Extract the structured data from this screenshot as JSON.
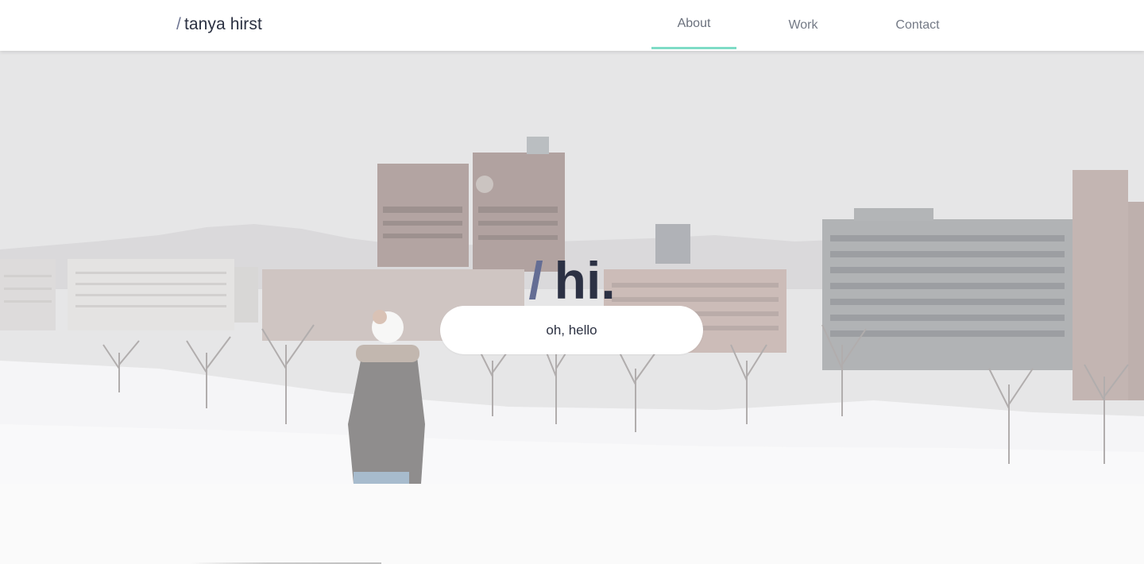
{
  "brand": {
    "slash": "/",
    "name": "tanya hirst"
  },
  "nav": {
    "items": [
      {
        "label": "About",
        "active": true
      },
      {
        "label": "Work",
        "active": false
      },
      {
        "label": "Contact",
        "active": false
      }
    ],
    "active_indicator_color": "#7fdcc6"
  },
  "hero": {
    "heading_slash": "/",
    "heading_text": "hi.",
    "button_label": "oh, hello",
    "background_image": "snowy-city-photo"
  },
  "colors": {
    "text_dark": "#2c3144",
    "slash_accent": "#646d94",
    "nav_text": "#747a86",
    "page_bg": "#fafafa"
  }
}
